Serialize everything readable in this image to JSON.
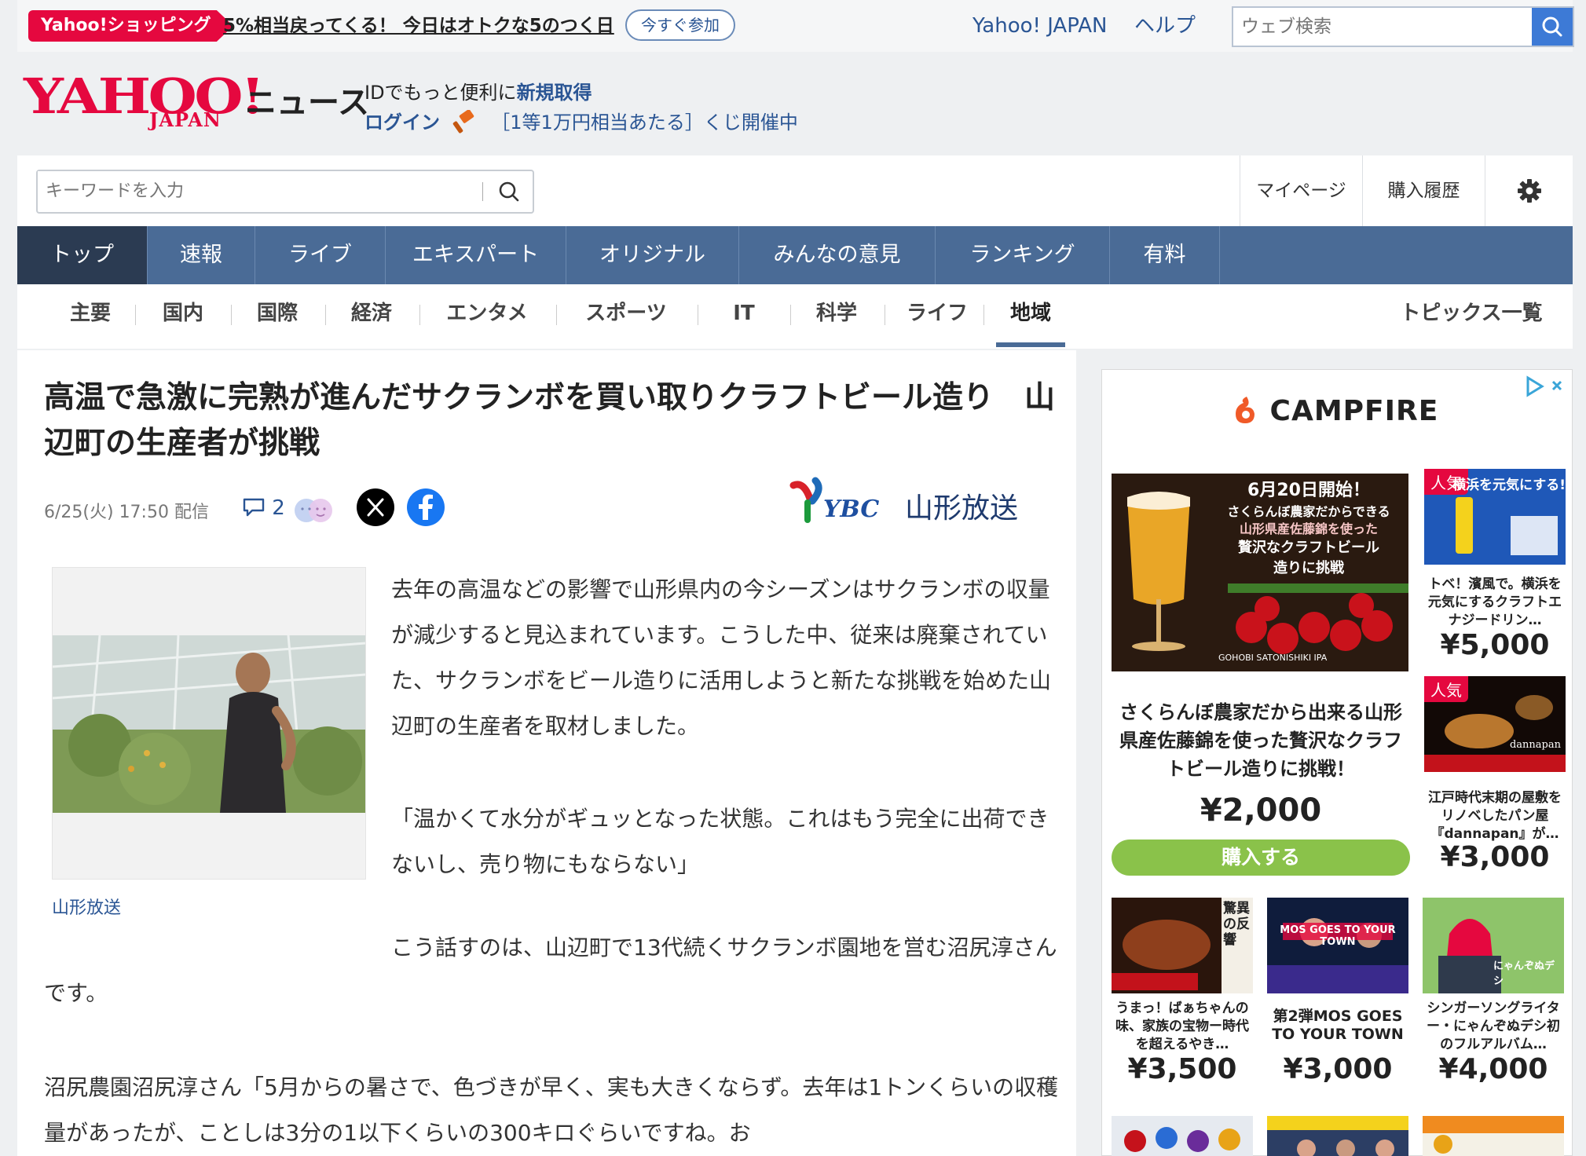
{
  "promo": {
    "badge": "Yahoo!ショッピング",
    "text": "5%相当戻ってくる！ 今日はオトクな5のつく日",
    "join": "今すぐ参加"
  },
  "top_links": {
    "yahoo_japan": "Yahoo! JAPAN",
    "help": "ヘルプ"
  },
  "web_search": {
    "placeholder": "ウェブ検索"
  },
  "header": {
    "logo": "YAHOO!",
    "logo_sub": "JAPAN",
    "service": "ニュース",
    "id_text": "IDでもっと便利に",
    "signup": "新規取得",
    "login": "ログイン",
    "lottery": "［1等1万円相当あたる］くじ開催中"
  },
  "news_search": {
    "placeholder": "キーワードを入力"
  },
  "account_menu": {
    "mypage": "マイページ",
    "history": "購入履歴"
  },
  "global_nav": [
    "トップ",
    "速報",
    "ライブ",
    "エキスパート",
    "オリジナル",
    "みんなの意見",
    "ランキング",
    "有料"
  ],
  "sub_nav": [
    "主要",
    "国内",
    "国際",
    "経済",
    "エンタメ",
    "スポーツ",
    "IT",
    "科学",
    "ライフ",
    "地域"
  ],
  "topics_link": "トピックス一覧",
  "article": {
    "title": "高温で急激に完熟が進んだサクランボを買い取りクラフトビール造り　山辺町の生産者が挑戦",
    "date": "6/25(火) 17:50 配信",
    "comment_count": "2",
    "source": "山形放送",
    "source_logo": "YBC",
    "photo_caption": "山形放送",
    "p1": "去年の高温などの影響で山形県内の今シーズンはサクランボの収量が減少すると見込まれています。こうした中、従来は廃棄されていた、サクランボをビール造りに活用しようと新たな挑戦を始めた山辺町の生産者を取材しました。",
    "p2": "「温かくて水分がギュッとなった状態。これはもう完全に出荷できないし、売り物にもならない」",
    "p3": "こう話すのは、山辺町で13代続くサクランボ園地を営む沼尻淳さんです。",
    "p4": "沼尻農園沼尻淳さん「5月からの暑さで、色づきが早く、実も大きくならず。去年は1トンくらいの収穫量があったが、ことしは3分の1以下くらいの300キロぐらいですね。お"
  },
  "ad": {
    "brand": "CAMPFIRE",
    "main_banner": {
      "headline": "6月20日開始！",
      "line1": "さくらんぼ農家だからできる",
      "line2": "山形県産佐藤錦を使った",
      "line3": "贅沢なクラフトビール",
      "line4": "造りに挑戦",
      "footer": "GOHOBI SATONISHIKI IPA"
    },
    "main_title": "さくらんぼ農家だから出来る山形県産佐藤錦を使った贅沢なクラフトビール造りに挑戦！",
    "main_price": "¥2,000",
    "buy": "購入する",
    "popular": "人気",
    "items": [
      {
        "title": "トベ！濱風で。横浜を元気にするクラフトエナジードリン…",
        "price": "¥5,000",
        "thumb_text": "横浜を元気にする!"
      },
      {
        "title": "江戸時代末期の屋敷をリノベしたパン屋『dannapan』が…",
        "price": "¥3,000",
        "thumb_text": "dannapan"
      },
      {
        "title": "うまっ！ばぁちゃんの味、家族の宝物ー時代を超えるやき…",
        "price": "¥3,500",
        "thumb_text": "驚異の反響"
      },
      {
        "title": "第2弾MOS GOES TO YOUR TOWN",
        "price": "¥3,000",
        "thumb_text": "MOS GOES TO YOUR TOWN"
      },
      {
        "title": "シンガーソングライター・にゃんぞぬデシ初のフルアルバム…",
        "price": "¥4,000",
        "thumb_text": "にゃんぞぬデシ"
      }
    ]
  },
  "colors": {
    "accent_red": "#e5083f",
    "nav_blue": "#4a6b96",
    "link_blue": "#2a5594",
    "buy_green": "#8ac24a"
  }
}
